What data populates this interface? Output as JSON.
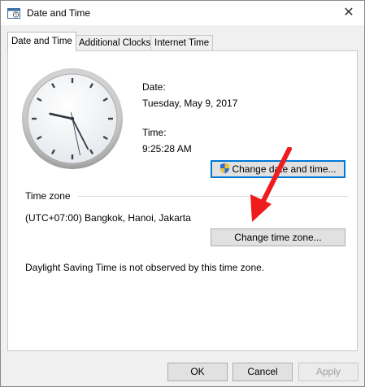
{
  "window": {
    "title": "Date and Time",
    "close_glyph": "✕"
  },
  "tabs": [
    {
      "label": "Date and Time",
      "active": true
    },
    {
      "label": "Additional Clocks",
      "active": false
    },
    {
      "label": "Internet Time",
      "active": false
    }
  ],
  "date_section": {
    "date_label": "Date:",
    "date_value": "Tuesday, May 9, 2017",
    "time_label": "Time:",
    "time_value": "9:25:28 AM",
    "change_button": "Change date and time..."
  },
  "timezone_section": {
    "group_label": "Time zone",
    "value": "(UTC+07:00) Bangkok, Hanoi, Jakarta",
    "change_button": "Change time zone..."
  },
  "dst_message": "Daylight Saving Time is not observed by this time zone.",
  "footer": {
    "ok": "OK",
    "cancel": "Cancel",
    "apply": "Apply"
  },
  "clock": {
    "hours": 9,
    "minutes": 25,
    "seconds": 28
  },
  "icons": [
    "calendar-clock-icon",
    "close-icon",
    "uac-shield-icon",
    "red-arrow-annotation"
  ]
}
